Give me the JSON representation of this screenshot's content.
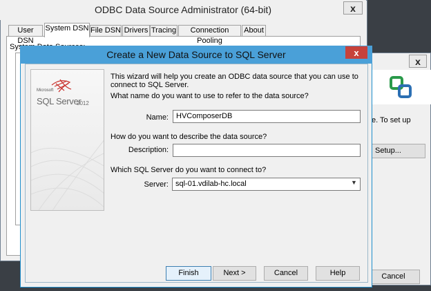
{
  "bg_window": {
    "title": "ODBC Data Source Administrator (64-bit)",
    "close_label": "x",
    "tabs": [
      {
        "label": "User DSN"
      },
      {
        "label": "System DSN"
      },
      {
        "label": "File DSN"
      },
      {
        "label": "Drivers"
      },
      {
        "label": "Tracing"
      },
      {
        "label": "Connection Pooling"
      },
      {
        "label": "About"
      }
    ],
    "panel_label": "System Data Sources:"
  },
  "bg_window2": {
    "close_label": "x",
    "text": "e. To set up",
    "setup_label": "Setup...",
    "cancel_label": "Cancel"
  },
  "dialog": {
    "title": "Create a New Data Source to SQL Server",
    "close_label": "x",
    "logo": {
      "microsoft": "Microsoft",
      "product": "SQL Server",
      "year": "2012"
    },
    "intro": "This wizard will help you create an ODBC data source that you can use to connect to SQL Server.",
    "name_question": "What name do you want to use to refer to the data source?",
    "name_label": "Name:",
    "name_value": "HVComposerDB",
    "desc_question": "How do you want to describe the data source?",
    "desc_label": "Description:",
    "desc_value": "",
    "server_question": "Which SQL Server do you want to connect to?",
    "server_label": "Server:",
    "server_value": "sql-01.vdilab-hc.local",
    "buttons": {
      "finish": "Finish",
      "next": "Next >",
      "cancel": "Cancel",
      "help": "Help"
    }
  }
}
